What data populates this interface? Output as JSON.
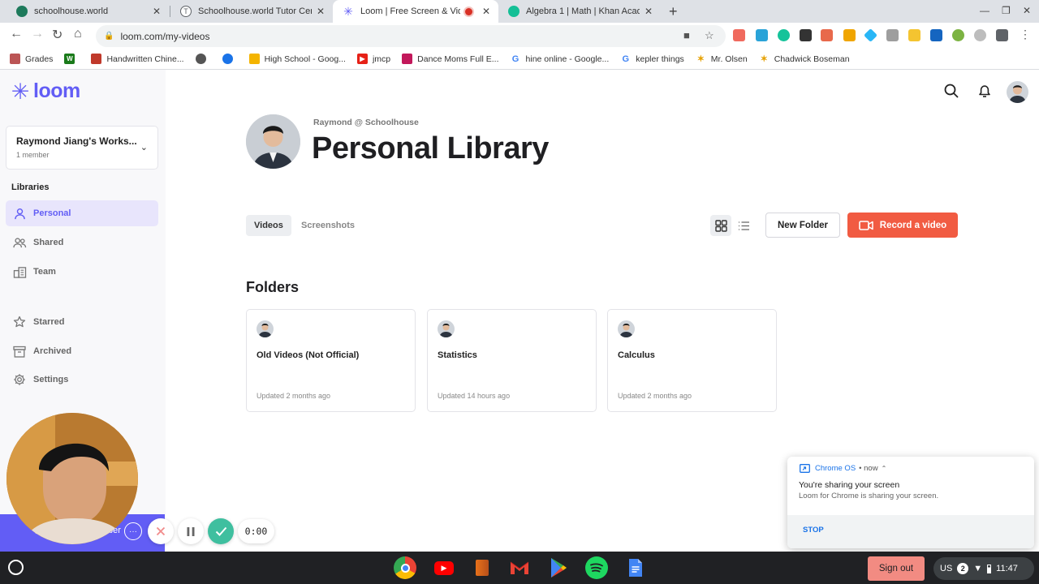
{
  "browser": {
    "tabs": [
      {
        "title": "schoolhouse.world",
        "fav_color": "#1e7a5c"
      },
      {
        "title": "Schoolhouse.world Tutor Certific",
        "fav_letter": "T",
        "fav_color": "#5f6368"
      },
      {
        "title": "Loom | Free Screen & Video",
        "active": true,
        "fav_color": "#625df5"
      },
      {
        "title": "Algebra 1 | Math | Khan Academ",
        "fav_color": "#14bf96"
      }
    ],
    "new_tab": "+",
    "url": "loom.com/my-videos",
    "bookmarks": [
      {
        "label": "Grades",
        "color": "#b55"
      },
      {
        "label": "",
        "color": "#1a7a1a"
      },
      {
        "label": "Handwritten Chine...",
        "color": "#c0392b"
      },
      {
        "label": "",
        "color": "#555"
      },
      {
        "label": "",
        "color": "#1a73e8"
      },
      {
        "label": "High School - Goog...",
        "color": "#f4b400"
      },
      {
        "label": "jmcp",
        "color": "#e62117"
      },
      {
        "label": "Dance Moms Full E...",
        "color": "#c2185b"
      },
      {
        "label": "hine online - Google...",
        "color": "#4285f4"
      },
      {
        "label": "kepler things",
        "color": "#4285f4"
      },
      {
        "label": "Mr. Olsen",
        "color": "#e6a100"
      },
      {
        "label": "Chadwick Boseman",
        "color": "#e6a100"
      }
    ]
  },
  "sidebar": {
    "logo": "loom",
    "workspace": {
      "name": "Raymond Jiang's Works...",
      "members": "1 member"
    },
    "libraries_heading": "Libraries",
    "items": [
      {
        "label": "Personal",
        "icon": "person-icon",
        "active": true
      },
      {
        "label": "Shared",
        "icon": "people-icon"
      },
      {
        "label": "Team",
        "icon": "building-icon"
      },
      {
        "label": "Starred",
        "icon": "star-icon"
      },
      {
        "label": "Archived",
        "icon": "archive-icon"
      },
      {
        "label": "Settings",
        "icon": "gear-icon"
      }
    ]
  },
  "main": {
    "owner": "Raymond @ Schoolhouse",
    "title": "Personal Library",
    "tabs": [
      "Videos",
      "Screenshots"
    ],
    "new_folder": "New Folder",
    "record": "Record a video",
    "folders_heading": "Folders",
    "folders": [
      {
        "name": "Old Videos (Not Official)",
        "updated": "Updated 2 months ago"
      },
      {
        "name": "Statistics",
        "updated": "Updated 14 hours ago"
      },
      {
        "name": "Calculus",
        "updated": "Updated 2 months ago"
      }
    ]
  },
  "recorder": {
    "timer": "0:00",
    "bar_text": "+",
    "bar_tail": "ber",
    "more": "···"
  },
  "notification": {
    "source": "Chrome OS",
    "when": "• now",
    "heading": "You're sharing your screen",
    "body": "Loom for Chrome is sharing your screen.",
    "action": "STOP"
  },
  "shelf": {
    "sign_out": "Sign out",
    "locale": "US",
    "badge": "2",
    "time": "11:47"
  },
  "colors": {
    "brand": "#625df5",
    "record": "#f15b42"
  }
}
